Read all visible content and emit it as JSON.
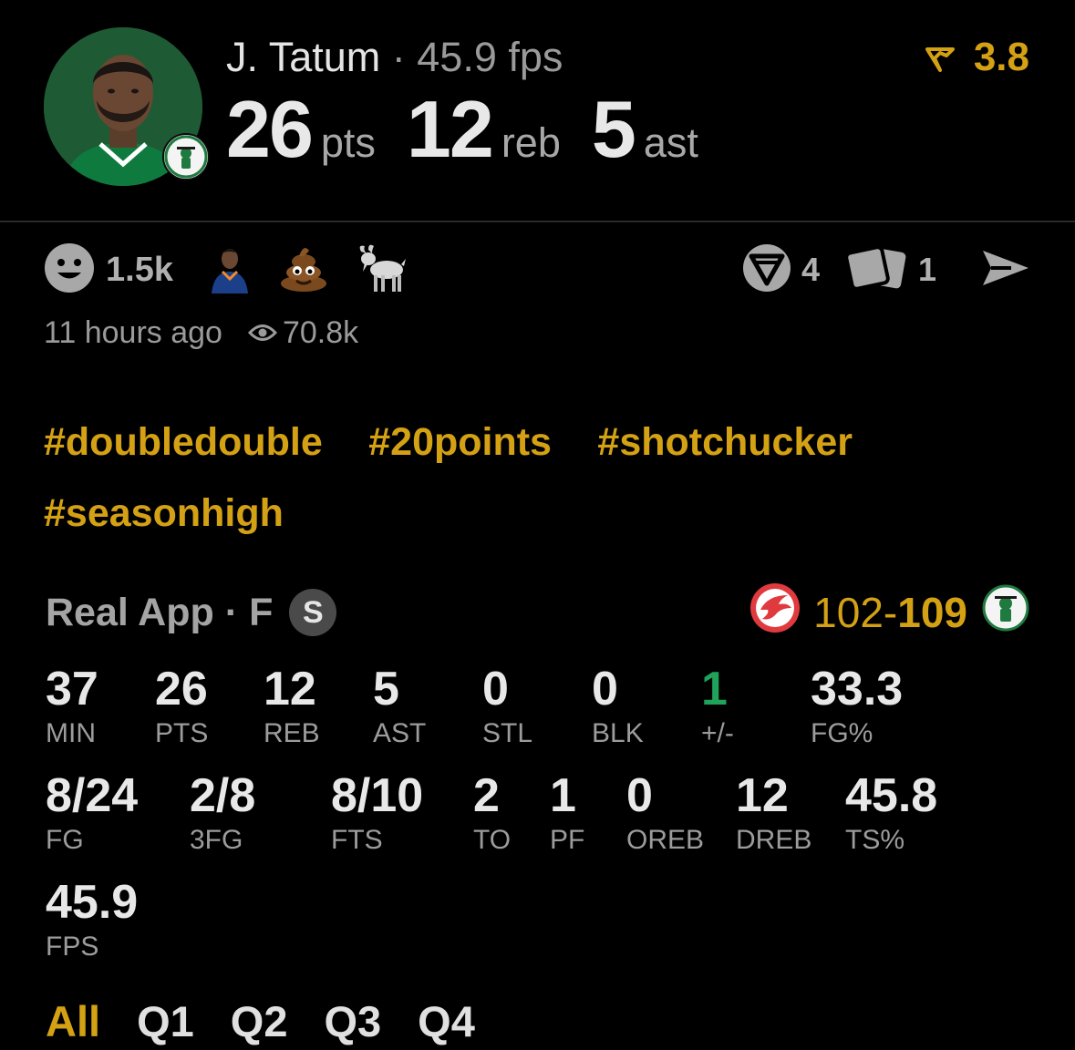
{
  "header": {
    "player_name": "J. Tatum",
    "separator": "·",
    "fps_text": "45.9 fps",
    "rating_value": "3.8",
    "stats": [
      {
        "value": "26",
        "unit": "pts"
      },
      {
        "value": "12",
        "unit": "reb"
      },
      {
        "value": "5",
        "unit": "ast"
      }
    ]
  },
  "reactions": {
    "count": "1.5k",
    "icons": [
      "smiley-icon",
      "player-emoji-icon",
      "poop-emoji-icon",
      "goat-emoji-icon"
    ]
  },
  "actions": {
    "comments_count": "4",
    "cards_count": "1"
  },
  "meta": {
    "time_ago": "11 hours ago",
    "views": "70.8k"
  },
  "hashtags": [
    "#doubledouble",
    "#20points",
    "#shotchucker",
    "#seasonhigh"
  ],
  "game": {
    "source": "Real App",
    "separator": "·",
    "position": "F",
    "badge": "S",
    "away_score": "102",
    "dash": "-",
    "home_score": "109"
  },
  "stat_rows": [
    [
      {
        "value": "37",
        "label": "MIN"
      },
      {
        "value": "26",
        "label": "PTS"
      },
      {
        "value": "12",
        "label": "REB"
      },
      {
        "value": "5",
        "label": "AST"
      },
      {
        "value": "0",
        "label": "STL"
      },
      {
        "value": "0",
        "label": "BLK"
      },
      {
        "value": "1",
        "label": "+/-"
      },
      {
        "value": "33.3",
        "label": "FG%"
      }
    ],
    [
      {
        "value": "8/24",
        "label": "FG"
      },
      {
        "value": "2/8",
        "label": "3FG"
      },
      {
        "value": "8/10",
        "label": "FTS"
      },
      {
        "value": "2",
        "label": "TO"
      },
      {
        "value": "1",
        "label": "PF"
      },
      {
        "value": "0",
        "label": "OREB"
      },
      {
        "value": "12",
        "label": "DREB"
      },
      {
        "value": "45.8",
        "label": "TS%"
      }
    ],
    [
      {
        "value": "45.9",
        "label": "FPS"
      }
    ]
  ],
  "tabs": [
    "All",
    "Q1",
    "Q2",
    "Q3",
    "Q4"
  ],
  "colors": {
    "background": "#000000",
    "accent_gold": "#d4a114",
    "positive_green": "#1fa35a",
    "muted_text": "#9c9c9c",
    "primary_text": "#e8e8e8",
    "celtics_green": "#1e5b35",
    "hawks_red": "#e03a3e"
  }
}
